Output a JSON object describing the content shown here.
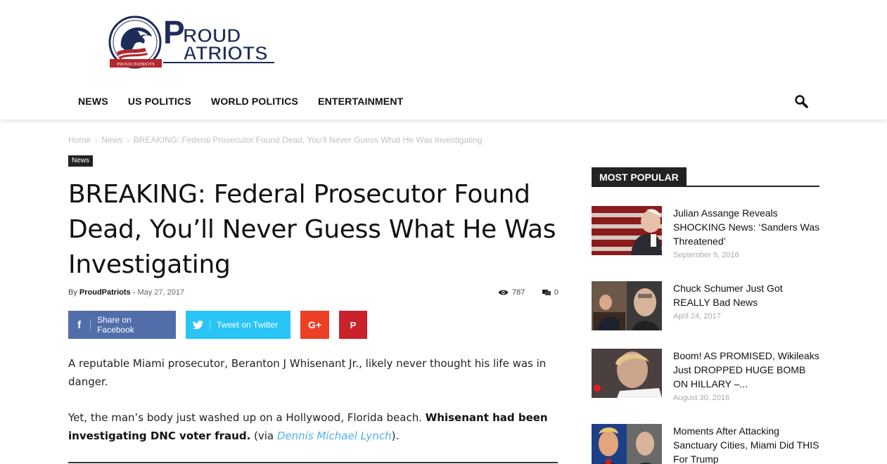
{
  "brand": {
    "name": "PROUD PATRIOTS",
    "logo_word1": "ROUD",
    "logo_word2": "ATRIOTS",
    "logo_letter": "P",
    "ribbon": "PROUD PATRIOTS"
  },
  "nav": {
    "items": [
      "NEWS",
      "US POLITICS",
      "WORLD POLITICS",
      "ENTERTAINMENT"
    ],
    "search_icon": "search-icon"
  },
  "breadcrumb": {
    "home": "Home",
    "section": "News",
    "current": "BREAKING: Federal Prosecutor Found Dead, You’ll Never Guess What He Was Investigating"
  },
  "article": {
    "category": "News",
    "title": "BREAKING: Federal Prosecutor Found Dead, You’ll Never Guess What He Was Investigating",
    "by": "By",
    "author": "ProudPatriots",
    "date_sep": "-",
    "date": "May 27, 2017",
    "views": "787",
    "comments": "0",
    "p1": "A reputable Miami prosecutor, Beranton J Whisenant Jr., likely never thought his life was in danger.",
    "p2_start": "Yet, the man’s body just washed up on a Hollywood, Florida beach. ",
    "p2_bold": "Whisenant had been investigating DNC voter fraud.",
    "p2_via": " (via ",
    "p2_link": "Dennis Michael Lynch",
    "p2_end": ")."
  },
  "share": {
    "facebook": "Share on Facebook",
    "twitter": "Tweet on Twitter"
  },
  "sidebar": {
    "heading": "MOST POPULAR",
    "items": [
      {
        "title": "Julian Assange Reveals SHOCKING News: ‘Sanders Was Threatened’",
        "date": "September 9, 2016"
      },
      {
        "title": "Chuck Schumer Just Got REALLY Bad News",
        "date": "April 24, 2017"
      },
      {
        "title": "Boom! AS PROMISED, Wikileaks Just DROPPED HUGE BOMB ON HILLARY –...",
        "date": "August 30, 2016"
      },
      {
        "title": "Moments After Attacking Sanctuary Cities, Miami Did THIS For Trump",
        "date": ""
      }
    ]
  },
  "colors": {
    "facebook": "#516eab",
    "twitter": "#29c5f6",
    "googleplus": "#eb4026",
    "pinterest": "#ca212a",
    "link": "#4db2ec",
    "logo_navy": "#1e2c5a",
    "logo_red": "#b3262d"
  }
}
